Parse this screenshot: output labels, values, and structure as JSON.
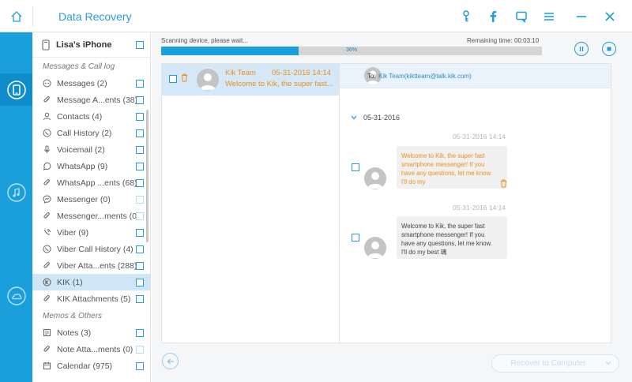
{
  "app": {
    "title": "Data Recovery"
  },
  "titlebar": {
    "icons": [
      "home-icon",
      "key-icon",
      "facebook-icon",
      "feedback-icon",
      "menu-icon",
      "minimize-icon",
      "close-icon"
    ]
  },
  "rail": {
    "items": [
      "ios-device-recover-icon",
      "itunes-recover-icon",
      "icloud-recover-icon"
    ]
  },
  "device": {
    "name": "Lisa's iPhone"
  },
  "sections": {
    "messages": "Messages & Call log",
    "memos": "Memos & Others"
  },
  "categories": [
    {
      "label": "Messages (2)",
      "icon": "chat-icon"
    },
    {
      "label": "Message A...ents (38)",
      "icon": "attachment-icon"
    },
    {
      "label": "Contacts (4)",
      "icon": "contact-icon"
    },
    {
      "label": "Call History (2)",
      "icon": "phone-icon"
    },
    {
      "label": "Voicemail (2)",
      "icon": "microphone-icon"
    },
    {
      "label": "WhatsApp (9)",
      "icon": "whatsapp-icon"
    },
    {
      "label": "WhatsApp ...ents (68)",
      "icon": "attachment-icon"
    },
    {
      "label": "Messenger (0)",
      "icon": "messenger-icon"
    },
    {
      "label": "Messenger...ments (0)",
      "icon": "attachment-icon"
    },
    {
      "label": "Viber (9)",
      "icon": "viber-icon"
    },
    {
      "label": "Viber Call History (4)",
      "icon": "phone-icon"
    },
    {
      "label": "Viber Atta...ents (288)",
      "icon": "attachment-icon"
    },
    {
      "label": "KIK (1)",
      "icon": "kik-icon"
    },
    {
      "label": "KIK Attachments (5)",
      "icon": "attachment-icon"
    }
  ],
  "memos": [
    {
      "label": "Notes (3)",
      "icon": "notes-icon"
    },
    {
      "label": "Note Atta...ments (0)",
      "icon": "attachment-icon"
    },
    {
      "label": "Calendar (975)",
      "icon": "calendar-icon"
    }
  ],
  "scan": {
    "status": "Scanning device, please wait...",
    "remaining": "Remaining time: 00:03:10",
    "progress_label": "36%",
    "progress": 0.36
  },
  "conversation": {
    "name": "Kik Team",
    "date": "05-31-2016 14:14",
    "preview": "Welcome to Kik, the super fast..."
  },
  "detail": {
    "to_label": "To:",
    "to_address": "Kik Team(kiktteam@talk.kik.com)",
    "day": "05-31-2016",
    "messages": [
      {
        "time": "05-31-2016 14:14",
        "lines": [
          "Welcome to Kik, the super fast",
          "smartphone messenger! If you",
          "have any questions, let me know.",
          "I'll do my"
        ]
      },
      {
        "time": "05-31-2016 14:14",
        "lines": [
          "Welcome to Kik, the super fast",
          "smartphone messenger! If you",
          "have any questions, let me know.",
          "I'll do my best 璃"
        ]
      }
    ]
  },
  "bottom": {
    "recover_label": "Recover to Computer"
  },
  "colors": {
    "accent": "#1a9fdc",
    "orange": "#f08f17",
    "active_bg": "#cfe6f6"
  }
}
